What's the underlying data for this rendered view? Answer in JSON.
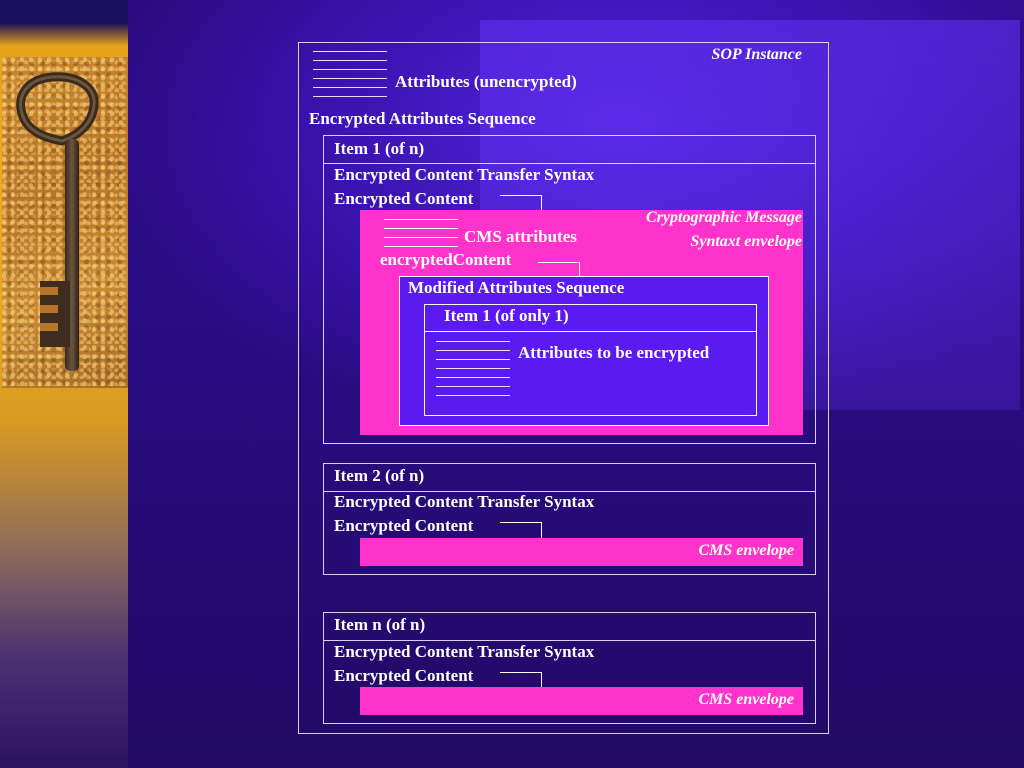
{
  "sop_instance": {
    "label": "SOP Instance",
    "attributes_label": "Attributes (unencrypted)"
  },
  "encrypted_sequence": {
    "label": "Encrypted Attributes Sequence"
  },
  "item1": {
    "header": "Item 1 (of n)",
    "transfer_syntax": "Encrypted Content Transfer Syntax",
    "content": "Encrypted Content",
    "envelope_line1": "Cryptographic Message",
    "envelope_line2": "Syntaxt envelope",
    "cms_attributes": "CMS attributes",
    "encrypted_content": "encryptedContent",
    "modified_sequence": "Modified Attributes Sequence",
    "inner_item": "Item 1 (of only 1)",
    "attributes_to_encrypt": "Attributes to be encrypted"
  },
  "item2": {
    "header": "Item 2 (of n)",
    "transfer_syntax": "Encrypted Content Transfer Syntax",
    "content": "Encrypted Content",
    "envelope": "CMS envelope"
  },
  "itemn": {
    "header": "Item n (of n)",
    "transfer_syntax": "Encrypted Content Transfer Syntax",
    "content": "Encrypted Content",
    "envelope": "CMS envelope"
  },
  "colors": {
    "background": "#2a0c84",
    "envelope": "#ff33cc",
    "inner_box": "#5a1af0",
    "side_bar": "#eda817"
  },
  "icons": {
    "photo": "key-image"
  }
}
